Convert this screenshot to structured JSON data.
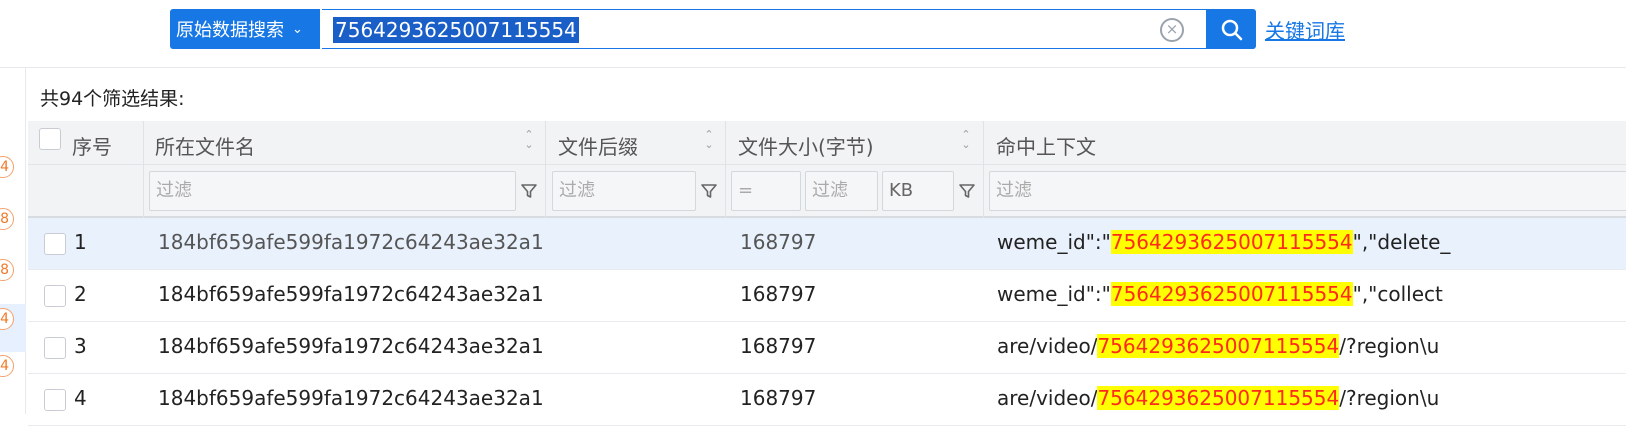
{
  "search": {
    "type_label": "原始数据搜索",
    "query": "7564293625007115554",
    "keyword_link": "关键词库"
  },
  "left_badges": [
    "4",
    "8",
    "8",
    "4",
    "4"
  ],
  "results": {
    "count_label": "共94个筛选结果:"
  },
  "table": {
    "headers": {
      "index": "序号",
      "filename": "所在文件名",
      "suffix": "文件后缀",
      "size": "文件大小(字节)",
      "context": "命中上下文"
    },
    "filters": {
      "filename_placeholder": "过滤",
      "suffix_placeholder": "过滤",
      "size_op": "=",
      "size_placeholder": "过滤",
      "size_unit": "KB",
      "context_placeholder": "过滤"
    },
    "rows": [
      {
        "index": "1",
        "filename": "184bf659afe599fa1972c64243ae32a1",
        "suffix": "",
        "size": "168797",
        "ctx_pre": "weme_id\":\"",
        "ctx_hit": "7564293625007115554",
        "ctx_post": "\",\"delete_"
      },
      {
        "index": "2",
        "filename": "184bf659afe599fa1972c64243ae32a1",
        "suffix": "",
        "size": "168797",
        "ctx_pre": "weme_id\":\"",
        "ctx_hit": "7564293625007115554",
        "ctx_post": "\",\"collect"
      },
      {
        "index": "3",
        "filename": "184bf659afe599fa1972c64243ae32a1",
        "suffix": "",
        "size": "168797",
        "ctx_pre": "are/video/",
        "ctx_hit": "7564293625007115554",
        "ctx_post": "/?region\\u"
      },
      {
        "index": "4",
        "filename": "184bf659afe599fa1972c64243ae32a1",
        "suffix": "",
        "size": "168797",
        "ctx_pre": "are/video/",
        "ctx_hit": "7564293625007115554",
        "ctx_post": "/?region\\u"
      }
    ]
  },
  "colors": {
    "accent": "#1677e5",
    "highlight_bg": "#ffff00",
    "highlight_text": "#ff2a1a",
    "badge": "#f07a2a"
  }
}
